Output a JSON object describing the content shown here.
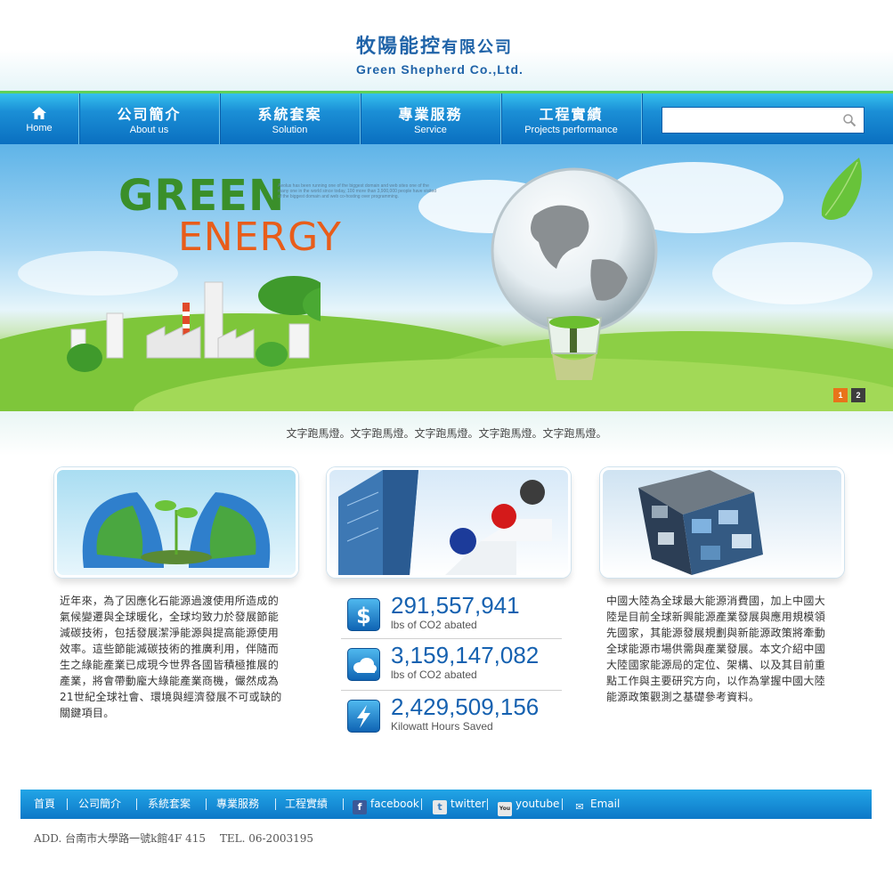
{
  "header": {
    "logo_cn_main": "牧陽能控",
    "logo_cn_suffix": "有限公司",
    "logo_en": "Green Shepherd Co.,Ltd."
  },
  "nav": {
    "items": [
      {
        "cn": "",
        "en": "Home",
        "icon": "home-icon"
      },
      {
        "cn": "公司簡介",
        "en": "About us"
      },
      {
        "cn": "系統套案",
        "en": "Solution"
      },
      {
        "cn": "專業服務",
        "en": "Service"
      },
      {
        "cn": "工程實績",
        "en": "Projects performance"
      }
    ],
    "search_placeholder": "",
    "search_icon": "search-icon"
  },
  "banner": {
    "headline_1": "GREEN",
    "headline_2": "ENERGY",
    "fine_print": "Aeolus has been running one of the biggest domain and web sites one of the many one in the world since today, 100 more than 3,900,000 people have visited of the biggest domain and web co-hosting over programming.",
    "slides": [
      "1",
      "2"
    ],
    "active_slide": 1
  },
  "marquee": {
    "text": "文字跑馬燈。文字跑馬燈。文字跑馬燈。文字跑馬燈。文字跑馬燈。"
  },
  "columns": {
    "left_text": [
      "近年來，為了因應化石能源過渡使用所造成的",
      "氣候變遷與全球暖化，全球均致力於發展節能",
      "減碳技術，包括發展潔淨能源與提高能源使用",
      "效率。這些節能減碳技術的推廣利用，伴隨而",
      "生之綠能產業已成現今世界各國皆積極推展的",
      "產業，將會帶動龐大綠能產業商機，儼然成為",
      "21世紀全球社會、環境與經濟發展不可或缺的",
      "關鍵項目。"
    ],
    "stats": [
      {
        "icon": "dollar-icon",
        "value": "291,557,941",
        "label": "lbs of CO2 abated"
      },
      {
        "icon": "cloud-icon",
        "value": "3,159,147,082",
        "label": "lbs of CO2 abated"
      },
      {
        "icon": "lightning-icon",
        "value": "2,429,509,156",
        "label": "Kilowatt Hours Saved"
      }
    ],
    "right_text": [
      "中國大陸為全球最大能源消費國，加上中國大",
      "陸是目前全球新興能源產業發展與應用規模領",
      "先國家，其能源發展規劃與新能源政策將牽動",
      "全球能源市場供需與產業發展。本文介紹中國",
      "大陸國家能源局的定位、架構、以及其目前重",
      "點工作與主要研究方向，以作為掌握中國大陸",
      "能源政策觀測之基礎參考資料。"
    ]
  },
  "footer": {
    "links": [
      "首頁",
      "公司簡介",
      "系統套案",
      "專業服務",
      "工程實績"
    ],
    "social": [
      {
        "label": "facebook",
        "icon": "facebook-icon",
        "glyph": "f"
      },
      {
        "label": "twitter",
        "icon": "twitter-icon",
        "glyph": "t"
      },
      {
        "label": "youtube",
        "icon": "youtube-icon",
        "glyph": "You"
      },
      {
        "label": "Email",
        "icon": "email-icon",
        "glyph": "✉"
      }
    ],
    "address": "ADD. 台南市大學路一號k館4F 415　 TEL. 06-2003195"
  },
  "colors": {
    "brand_blue": "#1f63a8",
    "nav_blue": "#0a6fc0",
    "accent_green": "#5fd05a",
    "energy_orange": "#e85d1a",
    "slide_active": "#e8731a"
  }
}
